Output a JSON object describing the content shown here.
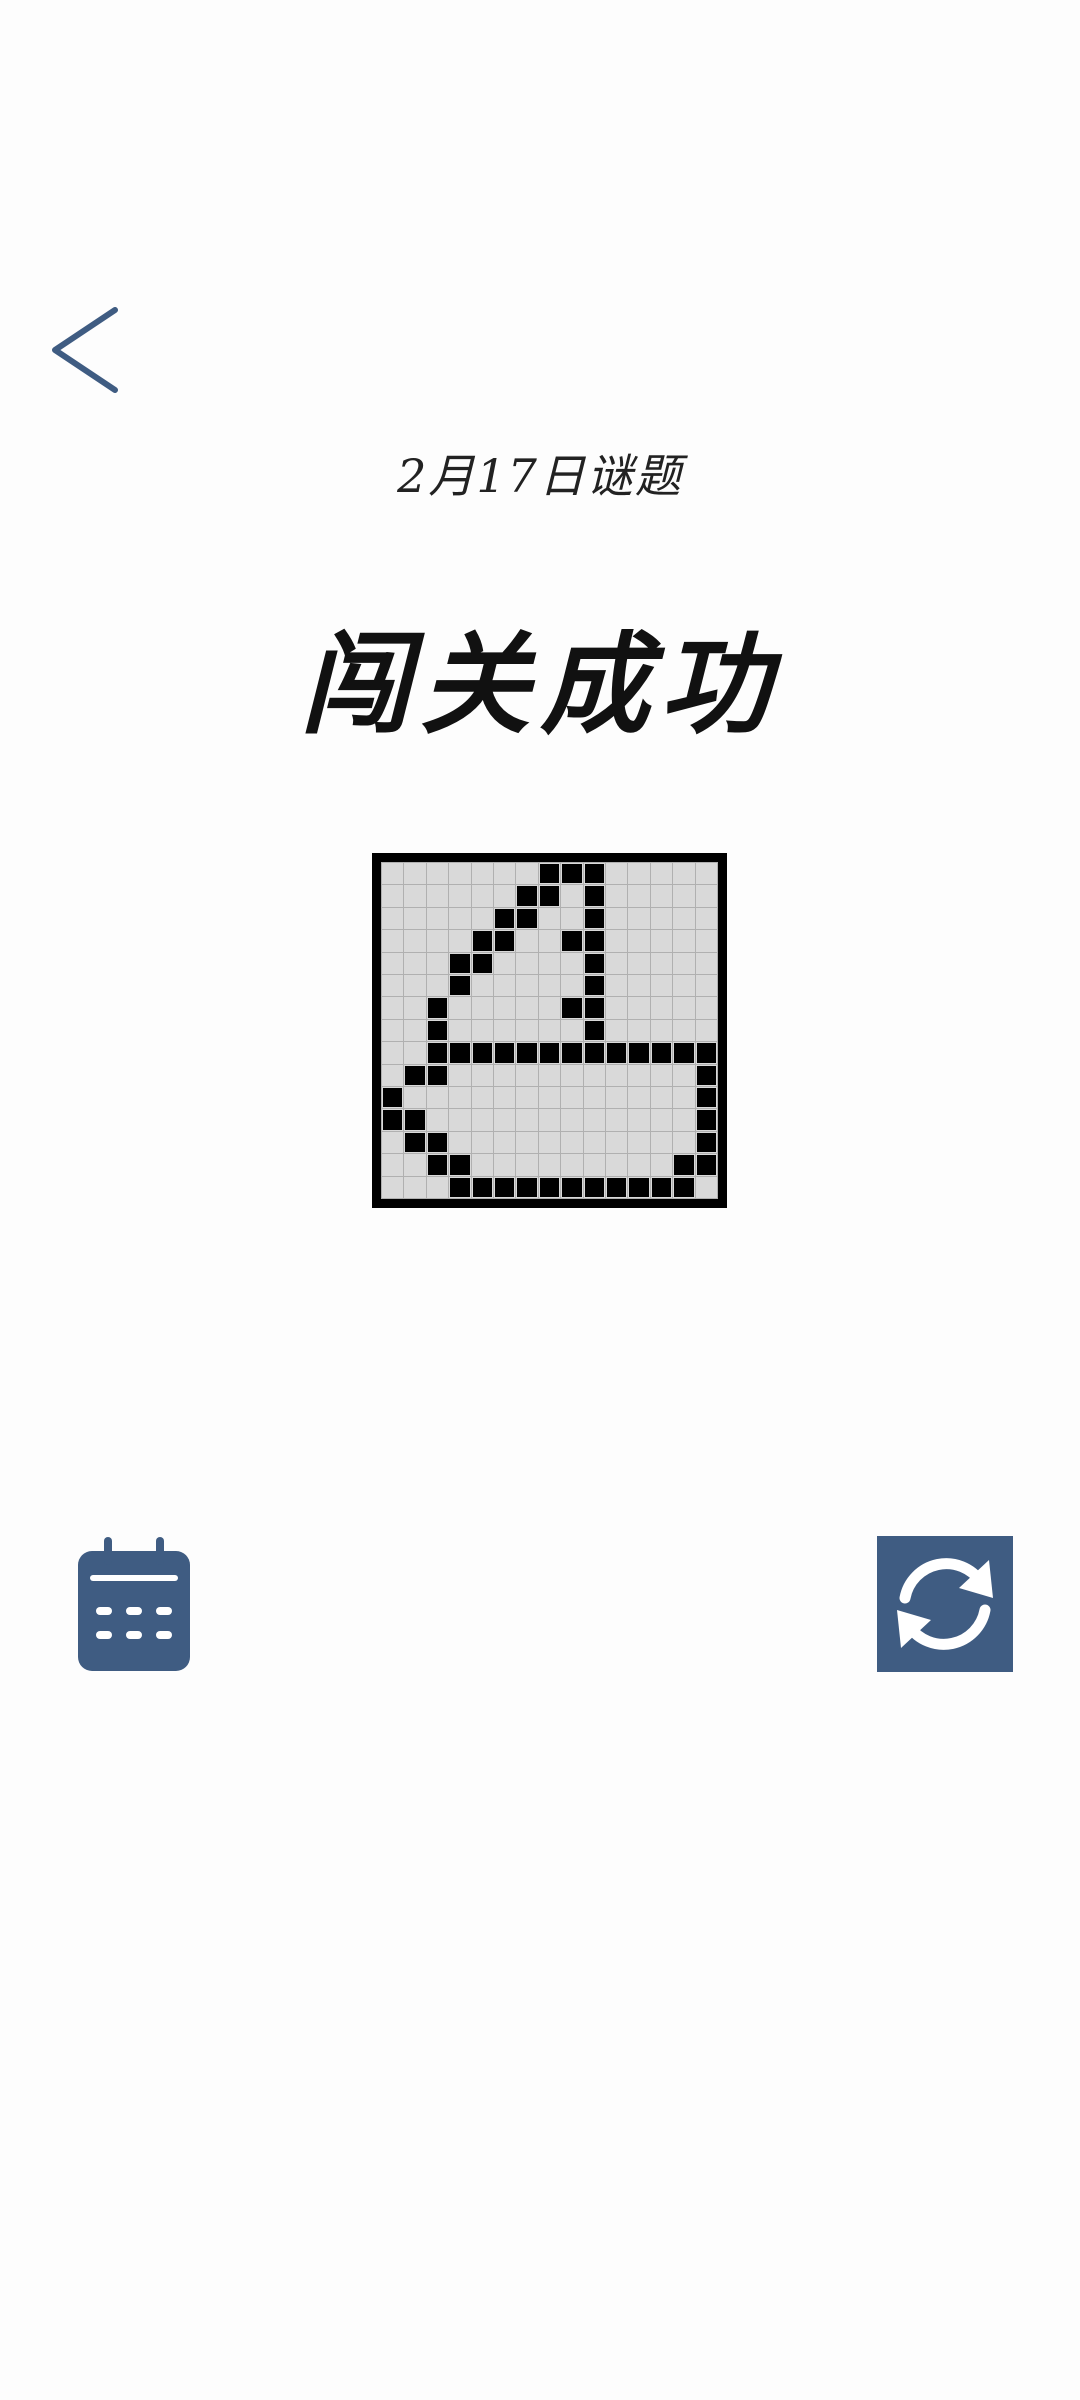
{
  "header": {
    "back_icon": "chevron-left-icon"
  },
  "puzzle": {
    "date_title": "2月17日谜题",
    "result_title": "闯关成功",
    "grid_size": 15,
    "filled_cells": [
      [
        0,
        7
      ],
      [
        0,
        8
      ],
      [
        0,
        9
      ],
      [
        1,
        6
      ],
      [
        1,
        7
      ],
      [
        1,
        9
      ],
      [
        2,
        5
      ],
      [
        2,
        6
      ],
      [
        2,
        9
      ],
      [
        3,
        4
      ],
      [
        3,
        5
      ],
      [
        3,
        8
      ],
      [
        3,
        9
      ],
      [
        4,
        3
      ],
      [
        4,
        4
      ],
      [
        4,
        9
      ],
      [
        5,
        3
      ],
      [
        5,
        9
      ],
      [
        6,
        2
      ],
      [
        6,
        8
      ],
      [
        6,
        9
      ],
      [
        7,
        2
      ],
      [
        7,
        9
      ],
      [
        8,
        2
      ],
      [
        8,
        3
      ],
      [
        8,
        4
      ],
      [
        8,
        5
      ],
      [
        8,
        6
      ],
      [
        8,
        7
      ],
      [
        8,
        8
      ],
      [
        8,
        9
      ],
      [
        8,
        10
      ],
      [
        8,
        11
      ],
      [
        8,
        12
      ],
      [
        8,
        13
      ],
      [
        8,
        14
      ],
      [
        9,
        1
      ],
      [
        9,
        2
      ],
      [
        9,
        14
      ],
      [
        10,
        0
      ],
      [
        10,
        14
      ],
      [
        11,
        0
      ],
      [
        11,
        1
      ],
      [
        11,
        14
      ],
      [
        12,
        1
      ],
      [
        12,
        2
      ],
      [
        12,
        14
      ],
      [
        13,
        2
      ],
      [
        13,
        3
      ],
      [
        13,
        13
      ],
      [
        13,
        14
      ],
      [
        14,
        3
      ],
      [
        14,
        4
      ],
      [
        14,
        5
      ],
      [
        14,
        6
      ],
      [
        14,
        7
      ],
      [
        14,
        8
      ],
      [
        14,
        9
      ],
      [
        14,
        10
      ],
      [
        14,
        11
      ],
      [
        14,
        12
      ],
      [
        14,
        13
      ]
    ]
  },
  "actions": {
    "calendar_icon": "calendar-icon",
    "refresh_icon": "refresh-icon"
  },
  "colors": {
    "accent": "#3f5c82",
    "cell_empty": "#d9d9d9",
    "cell_filled": "#000000"
  }
}
